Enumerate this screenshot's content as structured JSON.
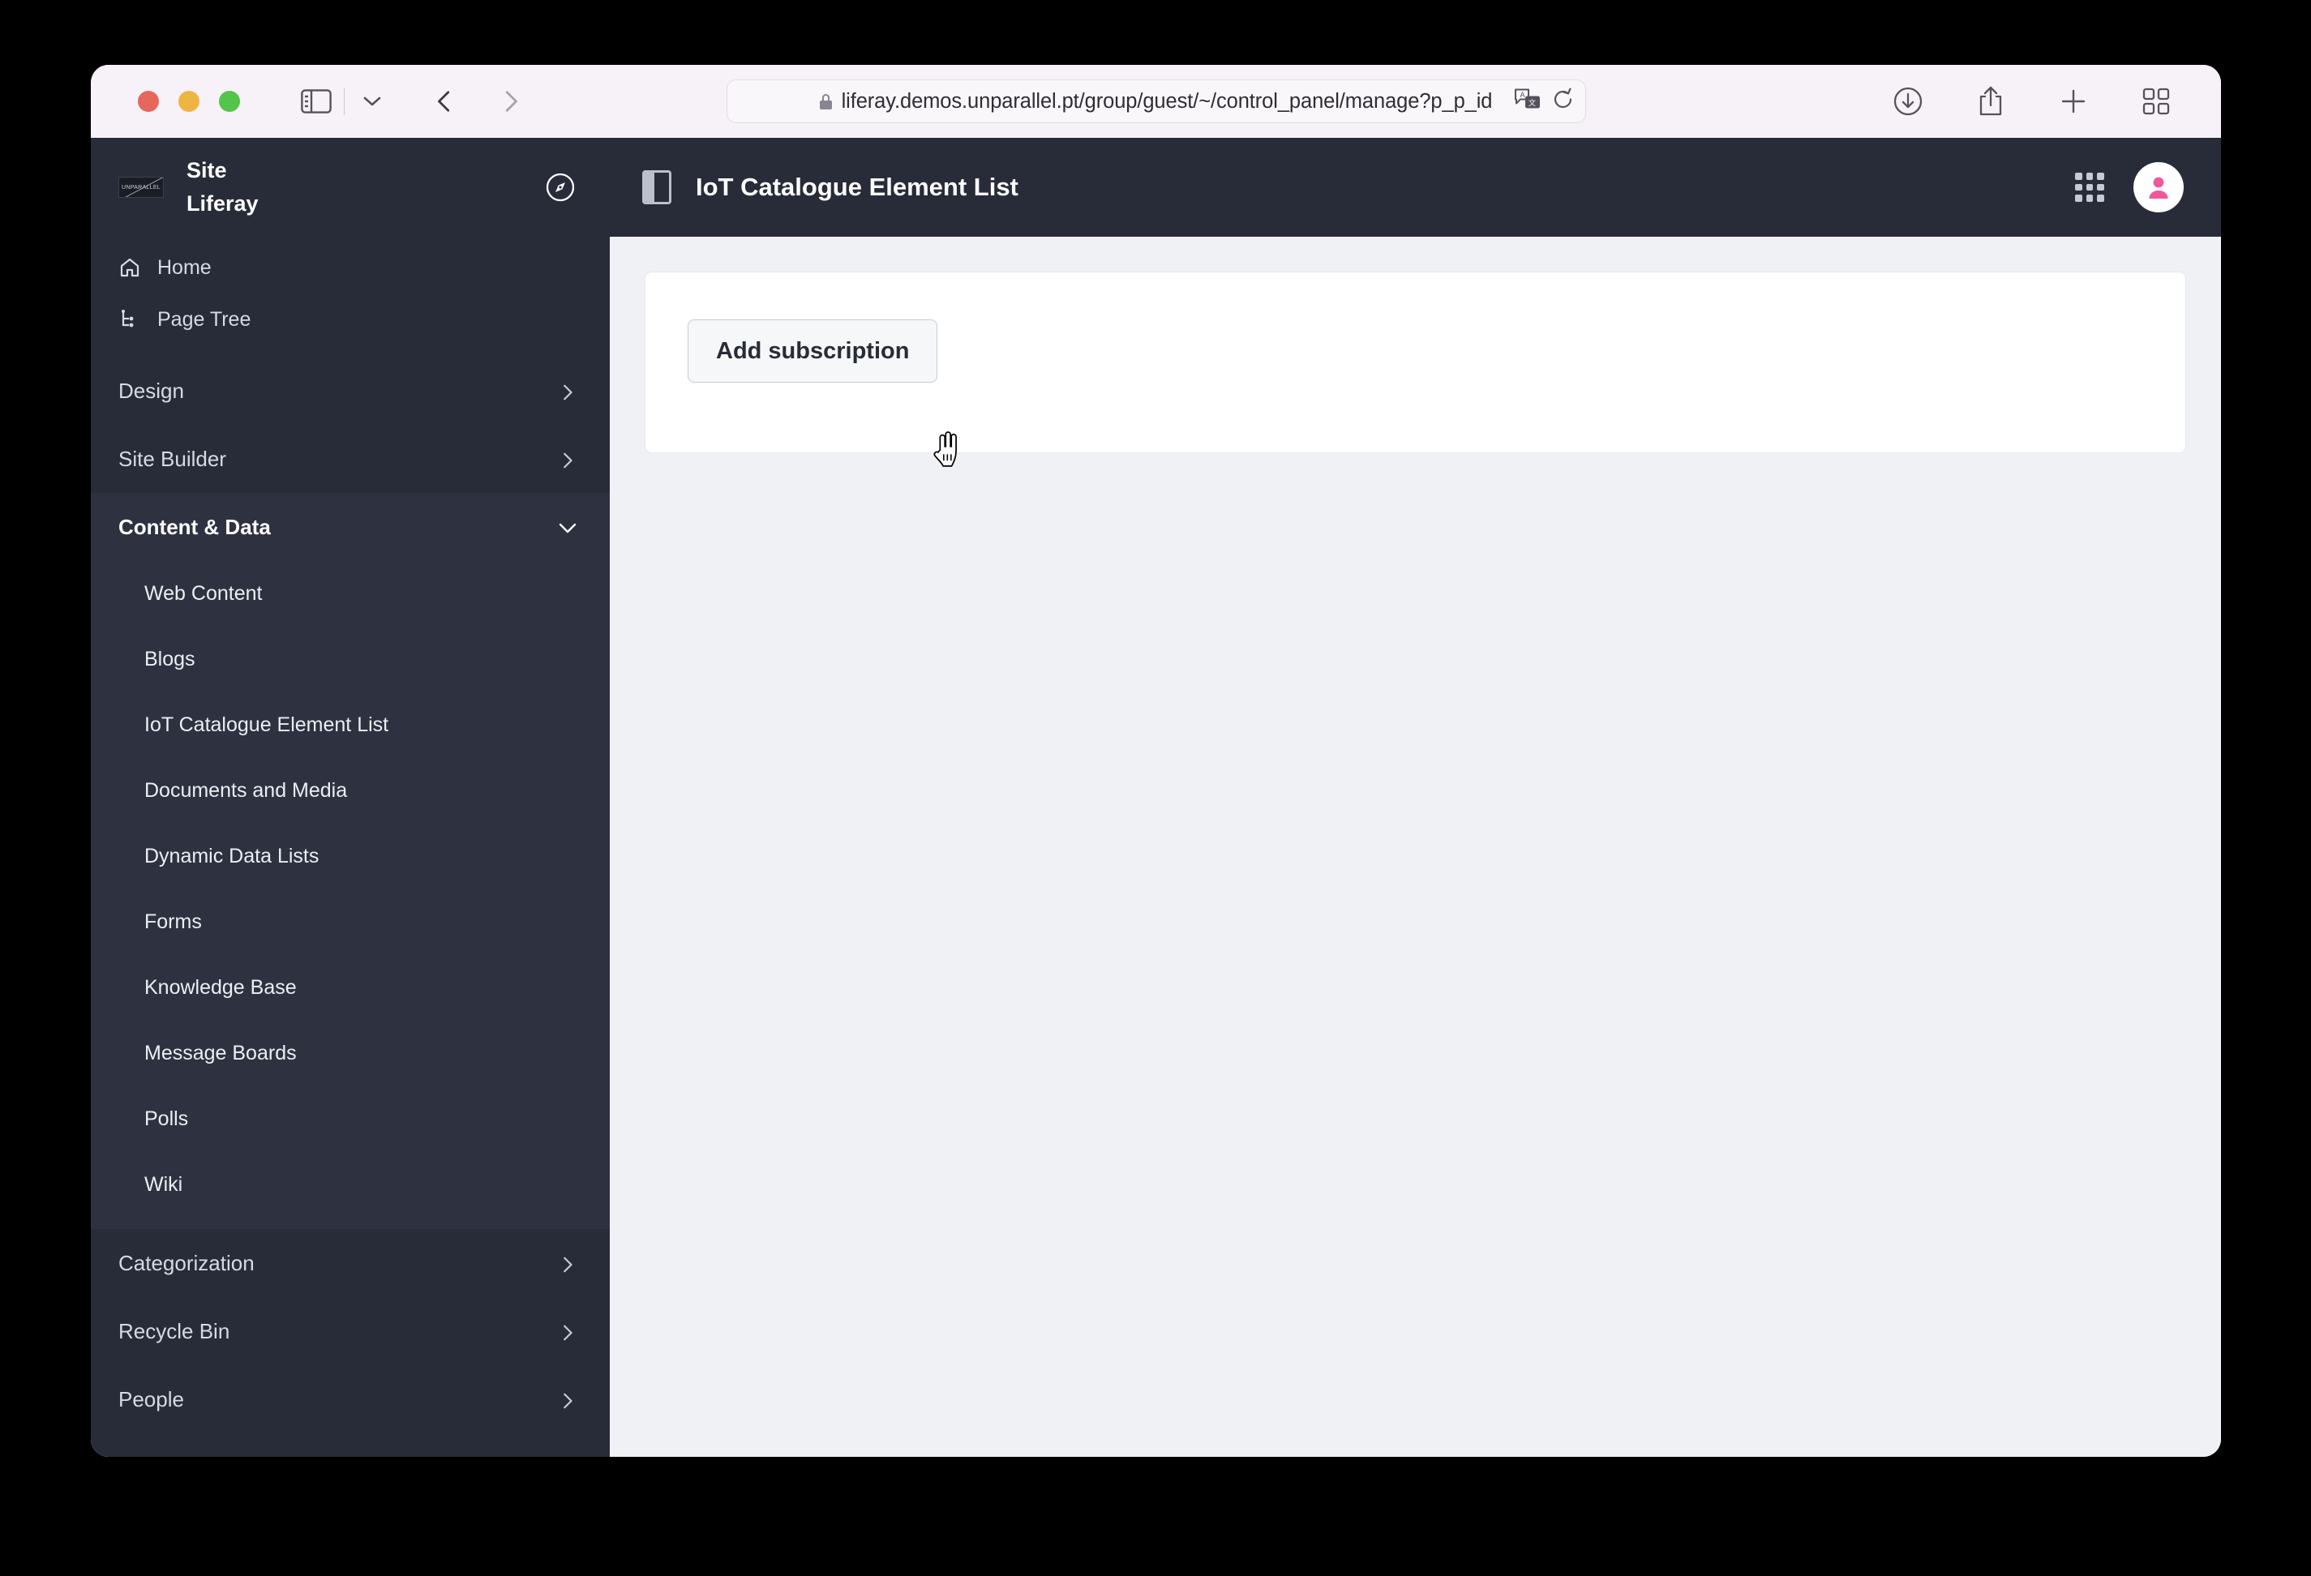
{
  "browser": {
    "window_controls": [
      "close",
      "minimize",
      "zoom"
    ],
    "sidebar_toggle_icon": "sidebar-icon",
    "tab_overview_chevron_icon": "chevron-down-icon",
    "back_icon": "chevron-left-icon",
    "forward_icon": "chevron-right-icon",
    "shield_icon": "privacy-shield-icon",
    "url": "liferay.demos.unparallel.pt/group/guest/~/control_panel/manage?p_p_id",
    "lock_icon": "lock-icon",
    "translate_icon": "translate-icon",
    "reload_icon": "reload-icon",
    "downloads_icon": "downloads-icon",
    "share_icon": "share-icon",
    "new_tab_icon": "plus-icon",
    "tab_grid_icon": "tab-overview-icon"
  },
  "sidebar": {
    "logo_text": "UNPARALLEL",
    "site_label": "Site",
    "site_name": "Liferay",
    "compass_icon": "compass-icon",
    "primary_items": [
      {
        "label": "Home",
        "icon": "home-icon"
      },
      {
        "label": "Page Tree",
        "icon": "page-tree-icon"
      }
    ],
    "sections": [
      {
        "label": "Design",
        "expanded": false,
        "chevron": "chevron-right-icon"
      },
      {
        "label": "Site Builder",
        "expanded": false,
        "chevron": "chevron-right-icon"
      },
      {
        "label": "Content & Data",
        "expanded": true,
        "chevron": "chevron-down-icon"
      }
    ],
    "content_data_items": [
      {
        "label": "Web Content"
      },
      {
        "label": "Blogs"
      },
      {
        "label": "IoT Catalogue Element List"
      },
      {
        "label": "Documents and Media"
      },
      {
        "label": "Dynamic Data Lists"
      },
      {
        "label": "Forms"
      },
      {
        "label": "Knowledge Base"
      },
      {
        "label": "Message Boards"
      },
      {
        "label": "Polls"
      },
      {
        "label": "Wiki"
      }
    ],
    "bottom_sections": [
      {
        "label": "Categorization",
        "chevron": "chevron-right-icon"
      },
      {
        "label": "Recycle Bin",
        "chevron": "chevron-right-icon"
      },
      {
        "label": "People",
        "chevron": "chevron-right-icon"
      }
    ]
  },
  "appbar": {
    "panel_toggle_icon": "panel-toggle-icon",
    "title": "IoT Catalogue Element List",
    "apps_grid_icon": "apps-grid-icon",
    "avatar_icon": "user-avatar-icon"
  },
  "main": {
    "add_subscription_label": "Add subscription",
    "cursor_icon": "pointer-hand-cursor"
  },
  "colors": {
    "sidebar_bg": "#282c38",
    "sidebar_expanded_bg": "#2e3240",
    "content_bg": "#eff1f5",
    "card_bg": "#ffffff",
    "avatar_accent": "#f0589c",
    "toolbar_bg": "#f7f2f7"
  }
}
